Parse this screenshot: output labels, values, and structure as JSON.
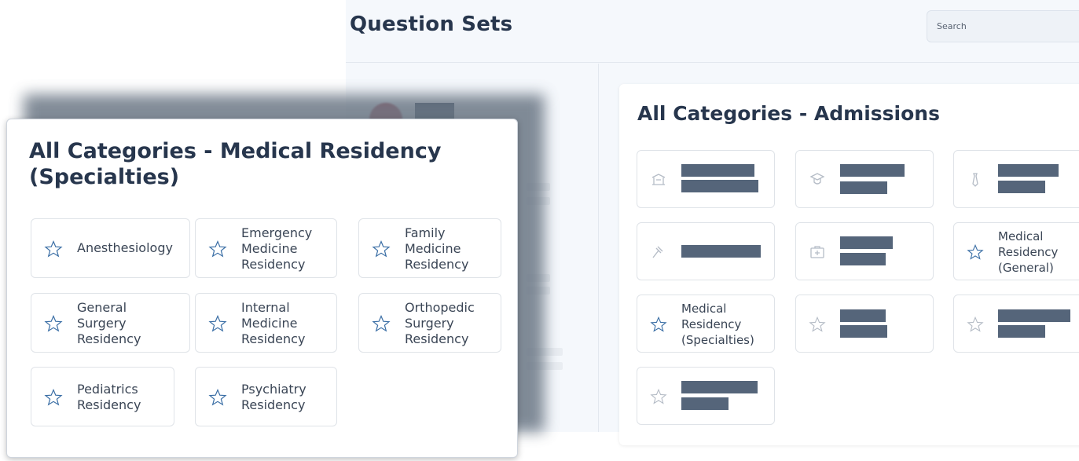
{
  "app": {
    "title": "Question Sets",
    "search_placeholder": "Search"
  },
  "admissions": {
    "title": "All Categories - Admissions",
    "visible_labels": {
      "medical_general": "Medical\nResidency\n(General)",
      "medical_specialties": "Medical\nResidency\n(Specialties)"
    },
    "icons": [
      "building-icon",
      "graduate-icon",
      "tie-icon",
      "gavel-icon",
      "medical-kit-icon",
      "star-icon",
      "star-icon",
      "star-icon",
      "star-icon",
      "star-icon"
    ]
  },
  "specialties": {
    "title": "All Categories - Medical Residency (Specialties)",
    "items": [
      {
        "label": "Anesthesiology"
      },
      {
        "label": "Emergency\nMedicine\nResidency"
      },
      {
        "label": "Family\nMedicine\nResidency"
      },
      {
        "label": "General\nSurgery\nResidency"
      },
      {
        "label": "Internal\nMedicine\nResidency"
      },
      {
        "label": "Orthopedic\nSurgery\nResidency"
      },
      {
        "label": "Pediatrics\nResidency"
      },
      {
        "label": "Psychiatry\nResidency"
      }
    ]
  },
  "colors": {
    "accent_star": "#3a6ea5",
    "redaction": "#55657a",
    "heading": "#27364d"
  }
}
